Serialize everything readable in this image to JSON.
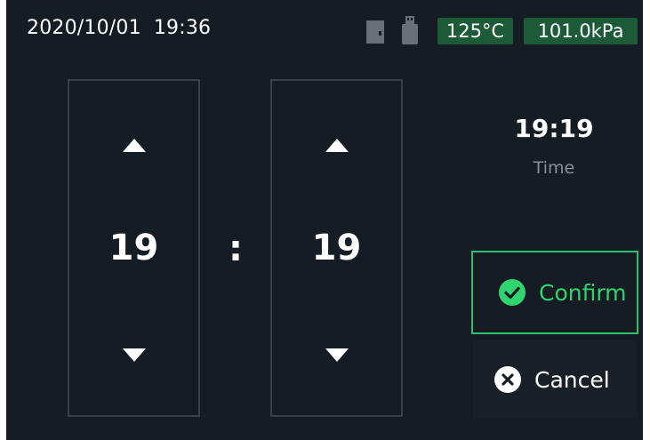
{
  "status_bar": {
    "date": "2020/10/01",
    "time": "19:36",
    "temperature": "125°C",
    "pressure": "101.0kPa",
    "icons": [
      "sd-card-icon",
      "usb-drive-icon"
    ]
  },
  "time_picker": {
    "hours": "19",
    "separator": ":",
    "minutes": "19"
  },
  "preview": {
    "value": "19:19",
    "caption": "Time"
  },
  "actions": {
    "confirm_label": "Confirm",
    "cancel_label": "Cancel"
  },
  "colors": {
    "background": "#161c24",
    "badge": "#1c5a38",
    "confirm_accent": "#2fd46f"
  }
}
